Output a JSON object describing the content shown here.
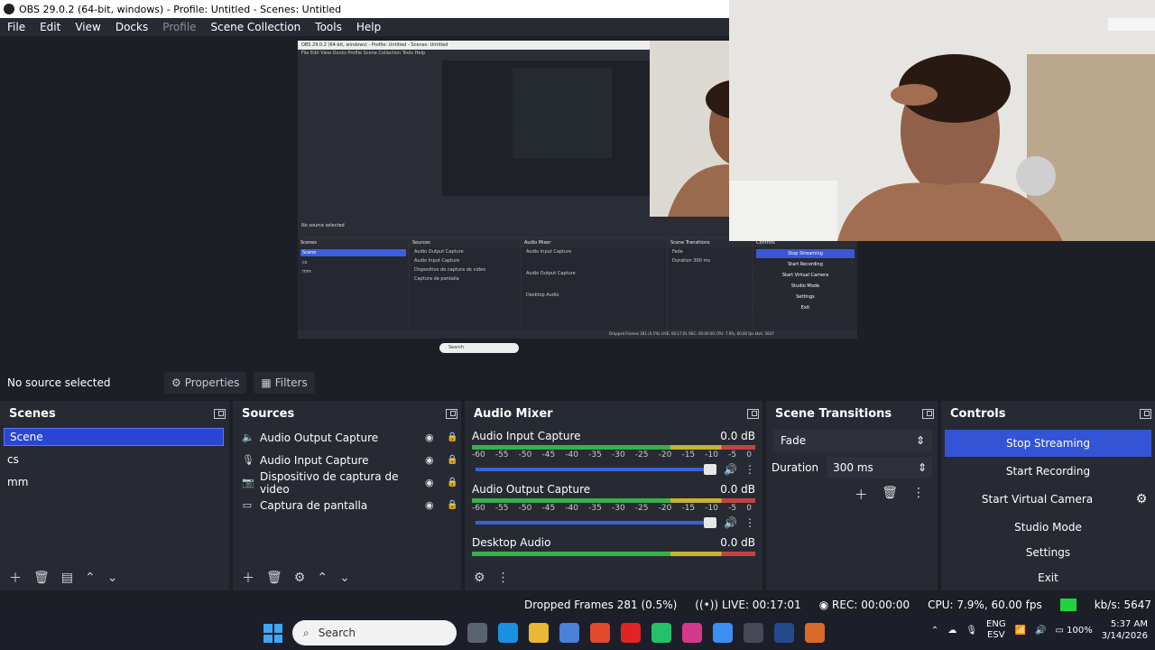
{
  "window": {
    "title": "OBS 29.0.2 (64-bit, windows) - Profile: Untitled - Scenes: Untitled"
  },
  "menu": {
    "items": [
      "File",
      "Edit",
      "View",
      "Docks",
      "Profile",
      "Scene Collection",
      "Tools",
      "Help"
    ]
  },
  "nested": {
    "title": "OBS 29.0.2 (64-bit, windows) - Profile: Untitled - Scenes: Untitled",
    "menu": "File   Edit   View   Docks   Profile   Scene Collection   Tools   Help",
    "no_source": "No source selected",
    "properties": "Properties",
    "filters": "Filters",
    "scenes_title": "Scenes",
    "sources_title": "Sources",
    "mixer_title": "Audio Mixer",
    "transitions_title": "Scene Transitions",
    "controls_title": "Controls",
    "scenes": [
      "Scene",
      "cs",
      "mm"
    ],
    "sources": [
      "Audio Output Capture",
      "Audio Input Capture",
      "Dispositivo de captura de video",
      "Captura de pantalla"
    ],
    "mixer": [
      "Audio Input Capture",
      "Audio Output Capture",
      "Desktop Audio"
    ],
    "transition": "Fade",
    "duration": "Duration",
    "duration_value": "300 ms",
    "controls": [
      "Stop Streaming",
      "Start Recording",
      "Start Virtual Camera",
      "Studio Mode",
      "Settings",
      "Exit"
    ],
    "status": "Dropped Frames 281 (0.5%)   LIVE: 00:17:01   REC: 00:00:00   CPU: 7.9%, 60.00 fps   kb/s: 5647",
    "search": "Search"
  },
  "source_bar": {
    "no_source": "No source selected",
    "properties": "Properties",
    "filters": "Filters"
  },
  "scenes": {
    "title": "Scenes",
    "items": [
      "Scene",
      "cs",
      "mm"
    ]
  },
  "sources": {
    "title": "Sources",
    "items": [
      {
        "label": "Audio Output Capture",
        "icon": "speaker-icon"
      },
      {
        "label": "Audio Input Capture",
        "icon": "microphone-icon"
      },
      {
        "label": "Dispositivo de captura de video",
        "icon": "camera-icon"
      },
      {
        "label": "Captura de pantalla",
        "icon": "monitor-icon"
      }
    ]
  },
  "mixer": {
    "title": "Audio Mixer",
    "channels": [
      {
        "name": "Audio Input Capture",
        "db": "0.0 dB"
      },
      {
        "name": "Audio Output Capture",
        "db": "0.0 dB"
      },
      {
        "name": "Desktop Audio",
        "db": "0.0 dB"
      }
    ],
    "ticks": [
      "-60",
      "-55",
      "-50",
      "-45",
      "-40",
      "-35",
      "-30",
      "-25",
      "-20",
      "-15",
      "-10",
      "-5",
      "0"
    ]
  },
  "transitions": {
    "title": "Scene Transitions",
    "type": "Fade",
    "duration_label": "Duration",
    "duration": "300 ms"
  },
  "controls": {
    "title": "Controls",
    "stop_streaming": "Stop Streaming",
    "start_recording": "Start Recording",
    "start_virtual_camera": "Start Virtual Camera",
    "studio_mode": "Studio Mode",
    "settings": "Settings",
    "exit": "Exit"
  },
  "status": {
    "dropped": "Dropped Frames 281 (0.5%)",
    "live": "LIVE: 00:17:01",
    "rec": "REC: 00:00:00",
    "cpu": "CPU: 7.9%, 60.00 fps",
    "kbs": "kb/s: 5647"
  },
  "taskbar": {
    "search": "Search",
    "lang1": "ENG",
    "lang2": "ESV",
    "battery": "100%",
    "time": "5:37 AM",
    "date": "3/14/2026"
  },
  "colors": {
    "accent": "#3454d6",
    "selected_scene": "#2946d6",
    "live_indicator": "#21d43f"
  }
}
